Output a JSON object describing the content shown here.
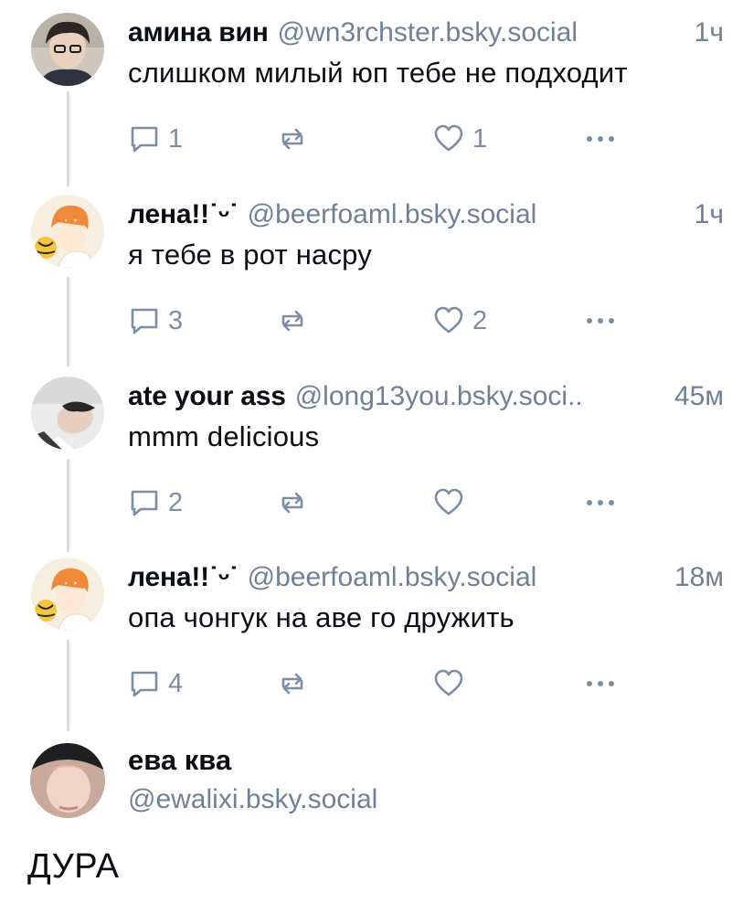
{
  "posts": [
    {
      "name": "амина вин",
      "handle": "@wn3rchster.bsky.social",
      "time": "1ч",
      "text": "слишком милый юп тебе не подходит",
      "replies": "1",
      "reposts": "",
      "likes": "1"
    },
    {
      "name": "лена!!˙ᵕ˙",
      "handle": "@beerfoaml.bsky.social",
      "time": "1ч",
      "text": "я тебе в рот насру",
      "replies": "3",
      "reposts": "",
      "likes": "2"
    },
    {
      "name": "ate your ass",
      "handle": "@long13you.bsky.soci..",
      "time": "45м",
      "text": "mmm delicious",
      "replies": "2",
      "reposts": "",
      "likes": ""
    },
    {
      "name": "лена!!˙ᵕ˙",
      "handle": "@beerfoaml.bsky.social",
      "time": "18м",
      "text": "опа чонгук на аве го дружить",
      "replies": "4",
      "reposts": "",
      "likes": ""
    }
  ],
  "focus_post": {
    "name": "ева ква",
    "handle": "@ewalixi.bsky.social",
    "text": "ДУРА"
  },
  "icons": {
    "reply": "speech-bubble-icon",
    "repost": "repost-arrows-icon",
    "like": "heart-outline-icon",
    "more": "ellipsis-icon"
  },
  "colors": {
    "text": "#0b0f14",
    "muted": "#6f8196",
    "icon": "#7b8ea3",
    "thread_line": "#d4dbe2"
  }
}
